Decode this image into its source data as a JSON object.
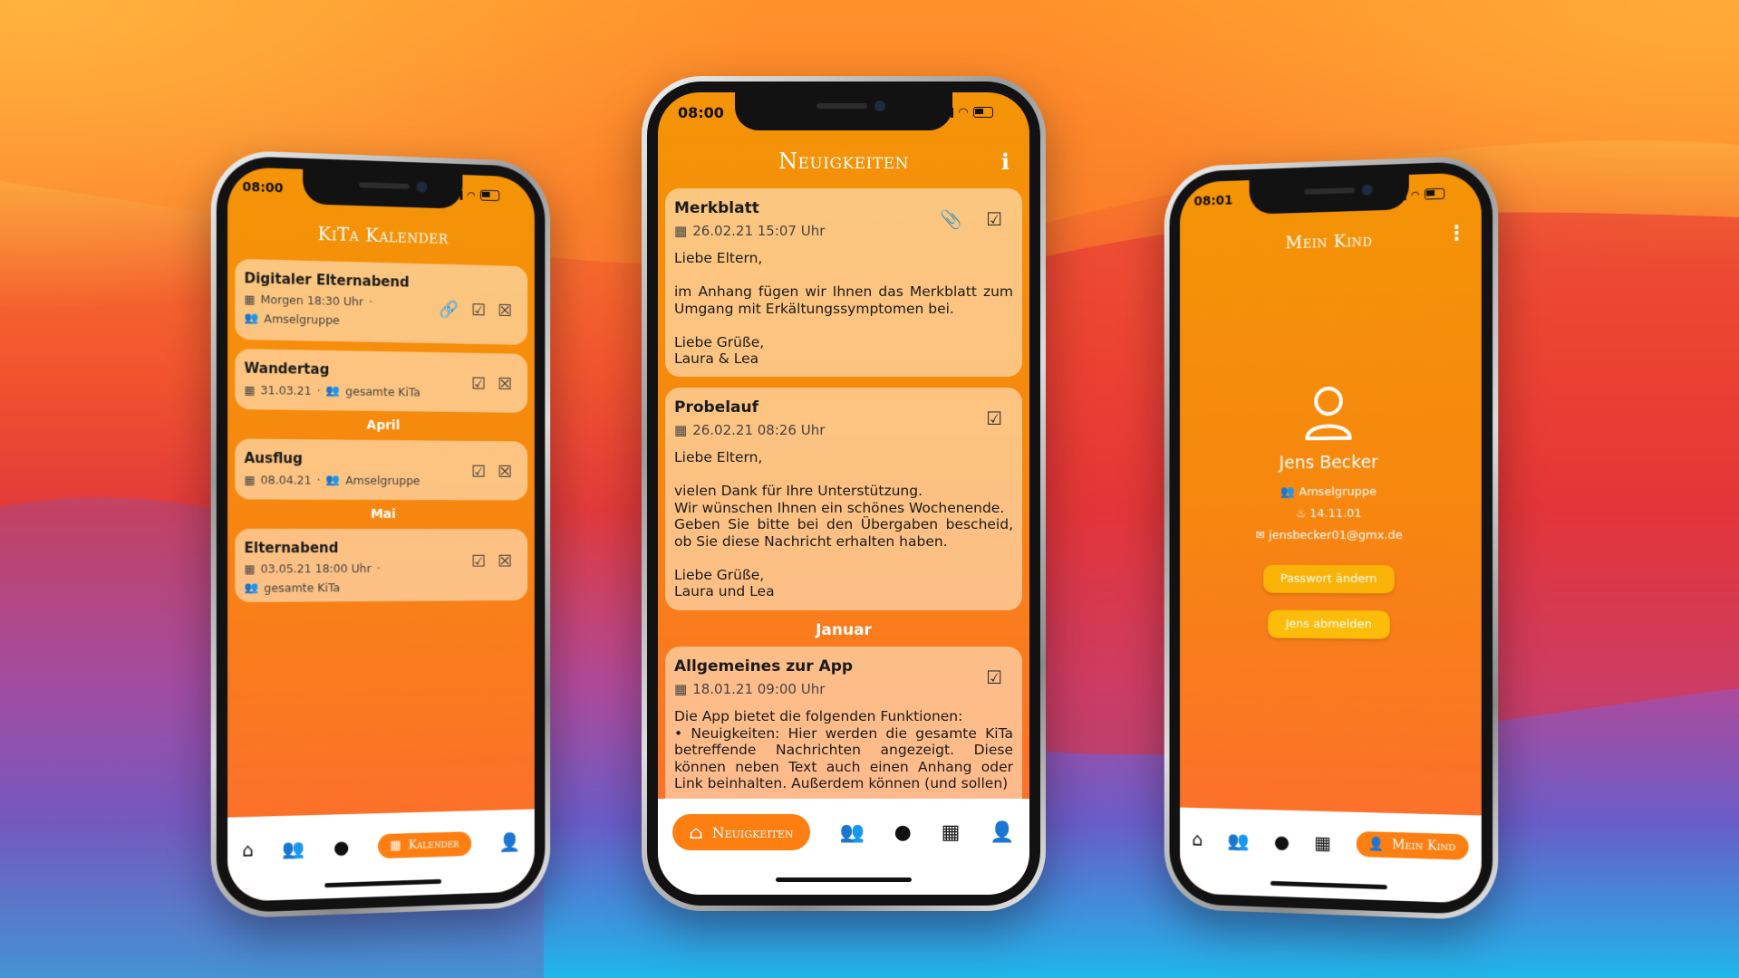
{
  "status": {
    "time_left": "08:00",
    "time_center": "08:00",
    "time_right": "08:01"
  },
  "calendar_screen": {
    "title": "KiTa Kalender",
    "events": [
      {
        "title": "Digitaler Elternabend",
        "date": "Morgen 18:30 Uhr",
        "group": "Amselgruppe"
      },
      {
        "title": "Wandertag",
        "date": "31.03.21",
        "group": "gesamte KiTa"
      }
    ],
    "month_april": "April",
    "april_events": [
      {
        "title": "Ausflug",
        "date": "08.04.21",
        "group": "Amselgruppe"
      }
    ],
    "month_may": "Mai",
    "may_events": [
      {
        "title": "Elternabend",
        "date": "03.05.21 18:00 Uhr",
        "group": "gesamte KiTa"
      }
    ],
    "active_tab": "Kalender"
  },
  "news_screen": {
    "title": "Neuigkeiten",
    "posts": [
      {
        "title": "Merkblatt",
        "date": "26.02.21 15:07 Uhr",
        "body": "Liebe Eltern,\n\nim Anhang fügen wir Ihnen das Merkblatt zum Umgang mit Erkältungssymptomen bei.\n\nLiebe Grüße,\nLaura & Lea"
      },
      {
        "title": "Probelauf",
        "date": "26.02.21 08:26 Uhr",
        "body": "Liebe Eltern,\n\nvielen Dank für Ihre Unterstützung.\nWir wünschen Ihnen ein schönes Wochenende.\nGeben Sie bitte bei den Übergaben bescheid, ob Sie diese Nachricht erhalten haben.\n\nLiebe Grüße,\nLaura und Lea"
      }
    ],
    "month_january": "Januar",
    "jan_post": {
      "title": "Allgemeines zur App",
      "date": "18.01.21 09:00 Uhr",
      "body": "Die App bietet die folgenden Funktionen:\n• Neuigkeiten: Hier werden die gesamte KiTa betreffende Nachrichten angezeigt. Diese können neben Text auch einen Anhang oder Link beinhalten. Außerdem können (und sollen)"
    },
    "active_tab": "Neuigkeiten"
  },
  "profile_screen": {
    "title": "Mein Kind",
    "name": "Jens Becker",
    "group": "Amselgruppe",
    "birthday": "14.11.01",
    "email": "jensbecker01@gmx.de",
    "change_password": "Passwort ändern",
    "logout": "Jens abmelden",
    "active_tab": "Mein Kind"
  },
  "colors": {
    "accent": "#fd7f12",
    "button_yellow": "#f9b208",
    "screen_top": "#f49406"
  }
}
